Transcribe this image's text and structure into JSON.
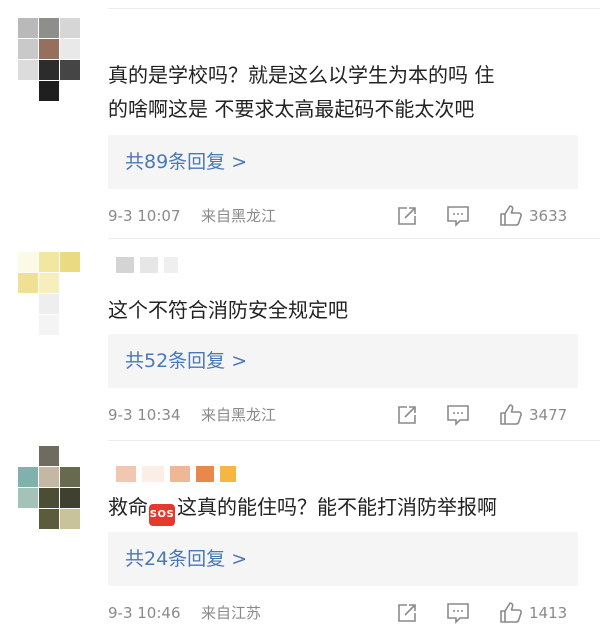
{
  "comments": [
    {
      "text_lines": [
        "真的是学校吗？就是这么以学生为本的吗 住",
        "的啥啊这是 不要求太高最起码不能太次吧"
      ],
      "reply_label": "共89条回复 >",
      "time": "9-3 10:07",
      "source": "来自黑龙江",
      "like_count": "3633"
    },
    {
      "text_lines": [
        "这个不符合消防安全规定吧"
      ],
      "reply_label": "共52条回复 >",
      "time": "9-3 10:34",
      "source": "来自黑龙江",
      "like_count": "3477"
    },
    {
      "text_before_emoji": "救命",
      "emoji": "SOS",
      "text_after_emoji": "这真的能住吗？能不能打消防举报啊",
      "reply_label": "共24条回复 >",
      "time": "9-3 10:46",
      "source": "来自江苏",
      "like_count": "1413"
    }
  ],
  "icons": {
    "share": "share-icon",
    "comment": "comment-icon",
    "like": "thumb-up-icon"
  },
  "colors": {
    "reply_link": "#4a78b5",
    "meta_text": "#8a8a8a",
    "reply_bg": "#f5f5f5"
  }
}
